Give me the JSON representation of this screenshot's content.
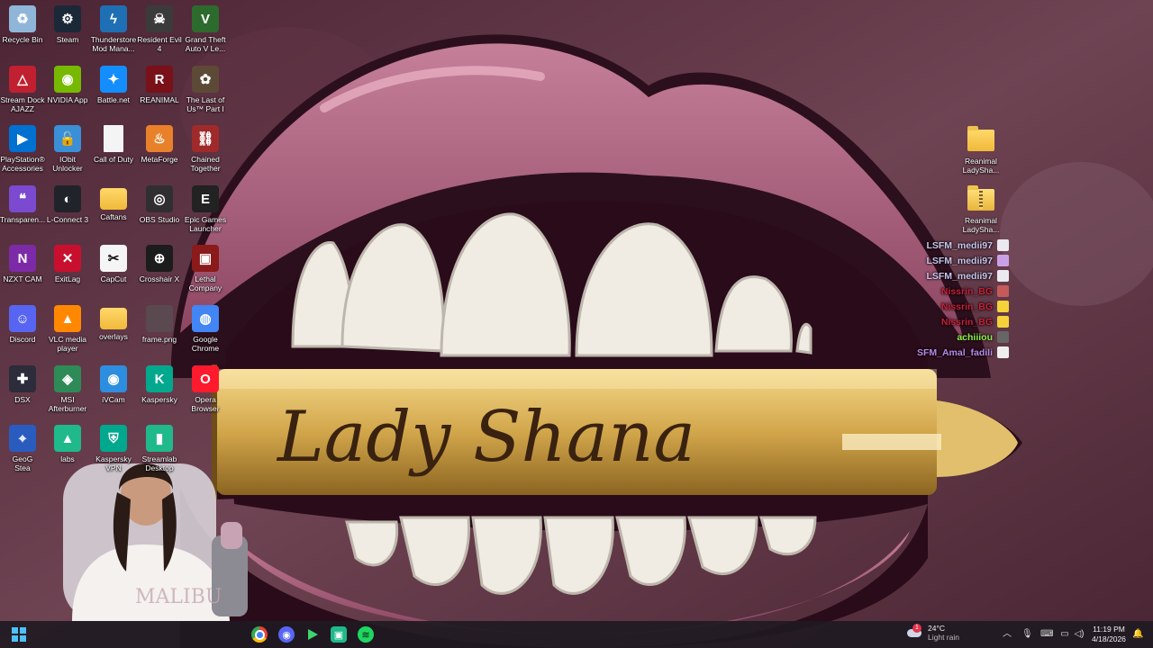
{
  "desktop": {
    "icons": [
      {
        "label": "Recycle Bin",
        "icon": "recycle-bin-icon"
      },
      {
        "label": "Steam",
        "icon": "steam-icon"
      },
      {
        "label": "Thunderstore\nMod Mana...",
        "icon": "thunderstore-icon"
      },
      {
        "label": "Resident Evil\n4",
        "icon": "resident-evil-icon"
      },
      {
        "label": "Grand Theft\nAuto V Le...",
        "icon": "gta-icon"
      },
      {
        "label": "Stream Dock\nAJAZZ",
        "icon": "stream-dock-icon"
      },
      {
        "label": "NVIDIA App",
        "icon": "nvidia-icon"
      },
      {
        "label": "Battle.net",
        "icon": "battlenet-icon"
      },
      {
        "label": "REANIMAL",
        "icon": "reanimal-icon"
      },
      {
        "label": "The Last of\nUs™ Part I",
        "icon": "last-of-us-icon"
      },
      {
        "label": "PlayStation®\nAccessories",
        "icon": "playstation-icon"
      },
      {
        "label": "IObit\nUnlocker",
        "icon": "iobit-icon"
      },
      {
        "label": "Call of Duty",
        "icon": "file-icon"
      },
      {
        "label": "MetaForge",
        "icon": "metaforge-icon"
      },
      {
        "label": "Chained\nTogether",
        "icon": "chained-together-icon"
      },
      {
        "label": "Transparen...",
        "icon": "chat-bubble-icon"
      },
      {
        "label": "L-Connect 3",
        "icon": "lconnect-icon"
      },
      {
        "label": "Caftans",
        "icon": "folder-icon"
      },
      {
        "label": "OBS Studio",
        "icon": "obs-icon"
      },
      {
        "label": "Epic Games\nLauncher",
        "icon": "epic-games-icon"
      },
      {
        "label": "NZXT CAM",
        "icon": "nzxt-icon"
      },
      {
        "label": "ExitLag",
        "icon": "exitlag-icon"
      },
      {
        "label": "CapCut",
        "icon": "capcut-icon"
      },
      {
        "label": "Crosshair X",
        "icon": "crosshair-icon"
      },
      {
        "label": "Lethal\nCompany",
        "icon": "lethal-company-icon"
      },
      {
        "label": "Discord",
        "icon": "discord-icon"
      },
      {
        "label": "VLC media\nplayer",
        "icon": "vlc-icon"
      },
      {
        "label": "overlays",
        "icon": "folder-icon"
      },
      {
        "label": "frame.png",
        "icon": "image-file-icon"
      },
      {
        "label": "Google\nChrome",
        "icon": "chrome-icon"
      },
      {
        "label": "DSX",
        "icon": "dsx-icon"
      },
      {
        "label": "MSI\nAfterburner",
        "icon": "msi-afterburner-icon"
      },
      {
        "label": "iVCam",
        "icon": "ivcam-icon"
      },
      {
        "label": "Kaspersky",
        "icon": "kaspersky-icon"
      },
      {
        "label": "Opera\nBrowser",
        "icon": "opera-icon"
      },
      {
        "label": "GeoG\nStea",
        "icon": "geoguessr-icon"
      },
      {
        "label": "labs",
        "icon": "streamlabs-icon"
      },
      {
        "label": "Kaspersky\nVPN",
        "icon": "kaspersky-vpn-icon"
      },
      {
        "label": "Streamlab\nDesktop",
        "icon": "streamlabs-desktop-icon"
      }
    ],
    "right_icons": [
      {
        "label": "Reanimal\nLadySha...",
        "icon": "folder-icon"
      },
      {
        "label": "Reanimal\nLadySha...",
        "icon": "zip-folder-icon"
      }
    ]
  },
  "wallpaper": {
    "logo_text": "Lady Shana"
  },
  "chat": {
    "lines": [
      {
        "name": "LSFM_medii97",
        "color": "#c9c6ee"
      },
      {
        "name": "LSFM_medii97",
        "color": "#c9c6ee"
      },
      {
        "name": "LSFM_medii97",
        "color": "#c9c6ee"
      },
      {
        "name": "Nissrin_BG",
        "color": "#c7203a"
      },
      {
        "name": "Nissrin_BG",
        "color": "#c7203a"
      },
      {
        "name": "Nissrin_BG",
        "color": "#c7203a"
      },
      {
        "name": "achiiiou",
        "color": "#8ff04a"
      },
      {
        "name": "SFM_Amal_fadili",
        "color": "#b88ae8"
      }
    ]
  },
  "taskbar": {
    "apps": [
      "windows-start-icon",
      "chrome-icon",
      "discord-icon",
      "steam-mod-icon",
      "app-icon",
      "spotify-icon"
    ],
    "weather": {
      "temp": "24°C",
      "condition": "Light rain",
      "alert_count": "1"
    },
    "clock": {
      "time": "11:19 PM",
      "date": "4/18/2026"
    }
  },
  "colors": {
    "lips": "#b06782",
    "lips_dark": "#3a1424",
    "bullet_gold": "#d7b25a",
    "background": "#5a3040"
  }
}
